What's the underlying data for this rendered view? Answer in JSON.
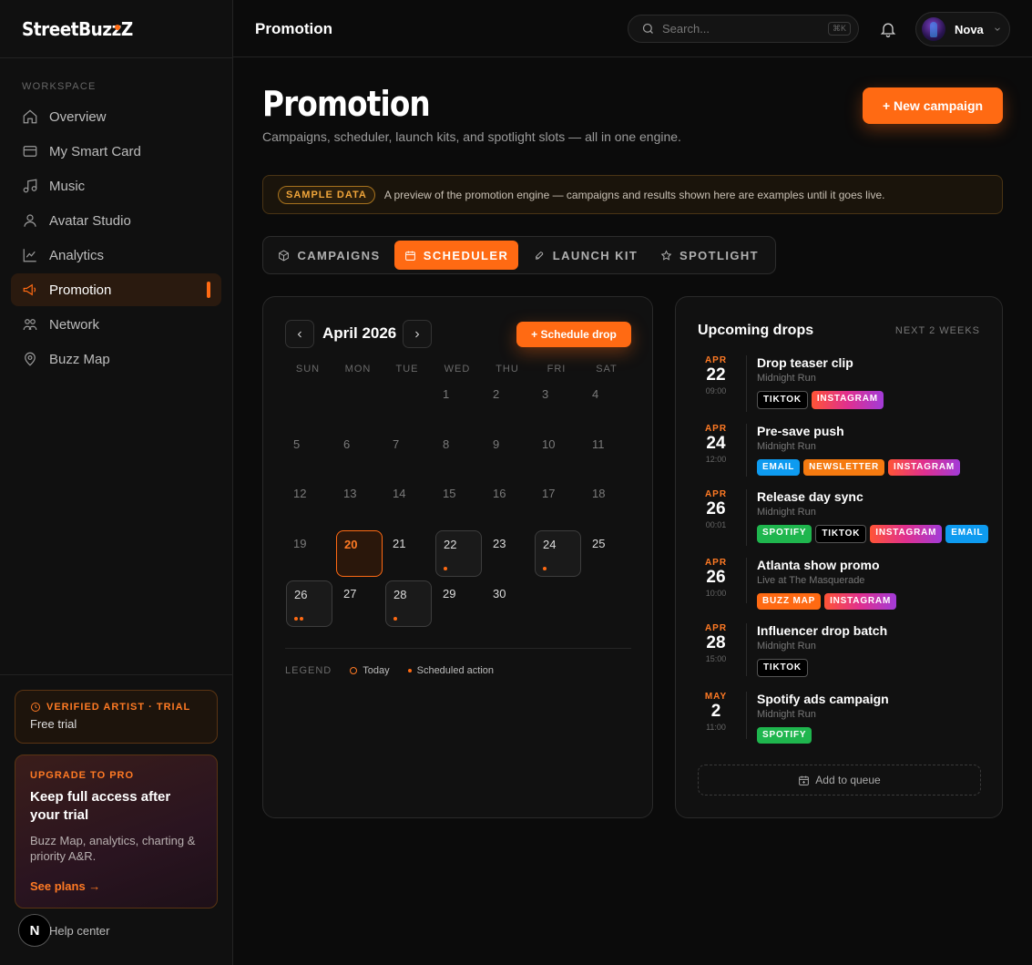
{
  "app": {
    "name": "StreetBuzzZ"
  },
  "sidebar": {
    "section_label": "WORKSPACE",
    "items": [
      {
        "label": "Overview",
        "icon": "home-icon"
      },
      {
        "label": "My Smart Card",
        "icon": "card-icon"
      },
      {
        "label": "Music",
        "icon": "music-icon"
      },
      {
        "label": "Avatar Studio",
        "icon": "user-icon"
      },
      {
        "label": "Analytics",
        "icon": "chart-icon"
      },
      {
        "label": "Promotion",
        "icon": "megaphone-icon",
        "active": true
      },
      {
        "label": "Network",
        "icon": "network-icon"
      },
      {
        "label": "Buzz Map",
        "icon": "map-pin-icon"
      }
    ],
    "trial": {
      "title": "VERIFIED ARTIST · TRIAL",
      "subtitle": "Free trial"
    },
    "upgrade": {
      "label": "UPGRADE TO PRO",
      "title": "Keep full access after your trial",
      "description": "Buzz Map, analytics, charting & priority A&R.",
      "link": "See plans →"
    },
    "help": {
      "badge": "N",
      "label": "Help center"
    }
  },
  "topbar": {
    "title": "Promotion",
    "search_placeholder": "Search...",
    "search_shortcut": "⌘K",
    "user_name": "Nova"
  },
  "page": {
    "title": "Promotion",
    "subtitle": "Campaigns, scheduler, launch kits, and spotlight slots — all in one engine.",
    "new_campaign": "+ New campaign",
    "banner_pill": "SAMPLE DATA",
    "banner_text": "A preview of the promotion engine — campaigns and results shown here are examples until it goes live."
  },
  "tabs": [
    {
      "label": "CAMPAIGNS",
      "icon": "box-icon"
    },
    {
      "label": "SCHEDULER",
      "icon": "calendar-icon",
      "active": true
    },
    {
      "label": "LAUNCH KIT",
      "icon": "rocket-icon"
    },
    {
      "label": "SPOTLIGHT",
      "icon": "star-icon"
    }
  ],
  "calendar": {
    "month_label": "April 2026",
    "schedule_button": "+ Schedule drop",
    "weekdays": [
      "SUN",
      "MON",
      "TUE",
      "WED",
      "THU",
      "FRI",
      "SAT"
    ],
    "days": [
      {
        "n": "1",
        "col": 3,
        "row": 0,
        "muted": true
      },
      {
        "n": "2",
        "col": 4,
        "row": 0,
        "muted": true
      },
      {
        "n": "3",
        "col": 5,
        "row": 0,
        "muted": true
      },
      {
        "n": "4",
        "col": 6,
        "row": 0,
        "muted": true
      },
      {
        "n": "5",
        "col": 0,
        "row": 1,
        "muted": true
      },
      {
        "n": "6",
        "col": 1,
        "row": 1,
        "muted": true
      },
      {
        "n": "7",
        "col": 2,
        "row": 1,
        "muted": true
      },
      {
        "n": "8",
        "col": 3,
        "row": 1,
        "muted": true
      },
      {
        "n": "9",
        "col": 4,
        "row": 1,
        "muted": true
      },
      {
        "n": "10",
        "col": 5,
        "row": 1,
        "muted": true
      },
      {
        "n": "11",
        "col": 6,
        "row": 1,
        "muted": true
      },
      {
        "n": "12",
        "col": 0,
        "row": 2,
        "muted": true
      },
      {
        "n": "13",
        "col": 1,
        "row": 2,
        "muted": true
      },
      {
        "n": "14",
        "col": 2,
        "row": 2,
        "muted": true
      },
      {
        "n": "15",
        "col": 3,
        "row": 2,
        "muted": true
      },
      {
        "n": "16",
        "col": 4,
        "row": 2,
        "muted": true
      },
      {
        "n": "17",
        "col": 5,
        "row": 2,
        "muted": true
      },
      {
        "n": "18",
        "col": 6,
        "row": 2,
        "muted": true
      },
      {
        "n": "19",
        "col": 0,
        "row": 3,
        "muted": true
      },
      {
        "n": "20",
        "col": 1,
        "row": 3,
        "today": true
      },
      {
        "n": "21",
        "col": 2,
        "row": 3
      },
      {
        "n": "22",
        "col": 3,
        "row": 3,
        "dots": 1
      },
      {
        "n": "23",
        "col": 4,
        "row": 3
      },
      {
        "n": "24",
        "col": 5,
        "row": 3,
        "dots": 1
      },
      {
        "n": "25",
        "col": 6,
        "row": 3
      },
      {
        "n": "26",
        "col": 0,
        "row": 4,
        "dots": 2
      },
      {
        "n": "27",
        "col": 1,
        "row": 4
      },
      {
        "n": "28",
        "col": 2,
        "row": 4,
        "dots": 1
      },
      {
        "n": "29",
        "col": 3,
        "row": 4
      },
      {
        "n": "30",
        "col": 4,
        "row": 4
      }
    ],
    "legend_label": "LEGEND",
    "legend_today": "Today",
    "legend_scheduled": "Scheduled action"
  },
  "upcoming": {
    "title": "Upcoming drops",
    "range": "NEXT 2 WEEKS",
    "drops": [
      {
        "month": "APR",
        "day": "22",
        "time": "09:00",
        "title": "Drop teaser clip",
        "subtitle": "Midnight Run",
        "tags": [
          {
            "label": "TIKTOK",
            "kind": "tiktok"
          },
          {
            "label": "INSTAGRAM",
            "kind": "instagram"
          }
        ]
      },
      {
        "month": "APR",
        "day": "24",
        "time": "12:00",
        "title": "Pre-save push",
        "subtitle": "Midnight Run",
        "tags": [
          {
            "label": "EMAIL",
            "kind": "email"
          },
          {
            "label": "NEWSLETTER",
            "kind": "newsletter"
          },
          {
            "label": "INSTAGRAM",
            "kind": "instagram"
          }
        ]
      },
      {
        "month": "APR",
        "day": "26",
        "time": "00:01",
        "title": "Release day sync",
        "subtitle": "Midnight Run",
        "tags": [
          {
            "label": "SPOTIFY",
            "kind": "spotify"
          },
          {
            "label": "TIKTOK",
            "kind": "tiktok"
          },
          {
            "label": "INSTAGRAM",
            "kind": "instagram"
          },
          {
            "label": "EMAIL",
            "kind": "email"
          }
        ]
      },
      {
        "month": "APR",
        "day": "26",
        "time": "10:00",
        "title": "Atlanta show promo",
        "subtitle": "Live at The Masquerade",
        "tags": [
          {
            "label": "BUZZ MAP",
            "kind": "buzzmap"
          },
          {
            "label": "INSTAGRAM",
            "kind": "instagram"
          }
        ]
      },
      {
        "month": "APR",
        "day": "28",
        "time": "15:00",
        "title": "Influencer drop batch",
        "subtitle": "Midnight Run",
        "tags": [
          {
            "label": "TIKTOK",
            "kind": "tiktok"
          }
        ]
      },
      {
        "month": "MAY",
        "day": "2",
        "time": "11:00",
        "title": "Spotify ads campaign",
        "subtitle": "Midnight Run",
        "tags": [
          {
            "label": "SPOTIFY",
            "kind": "spotify"
          }
        ]
      }
    ],
    "queue_button": "Add to queue"
  }
}
